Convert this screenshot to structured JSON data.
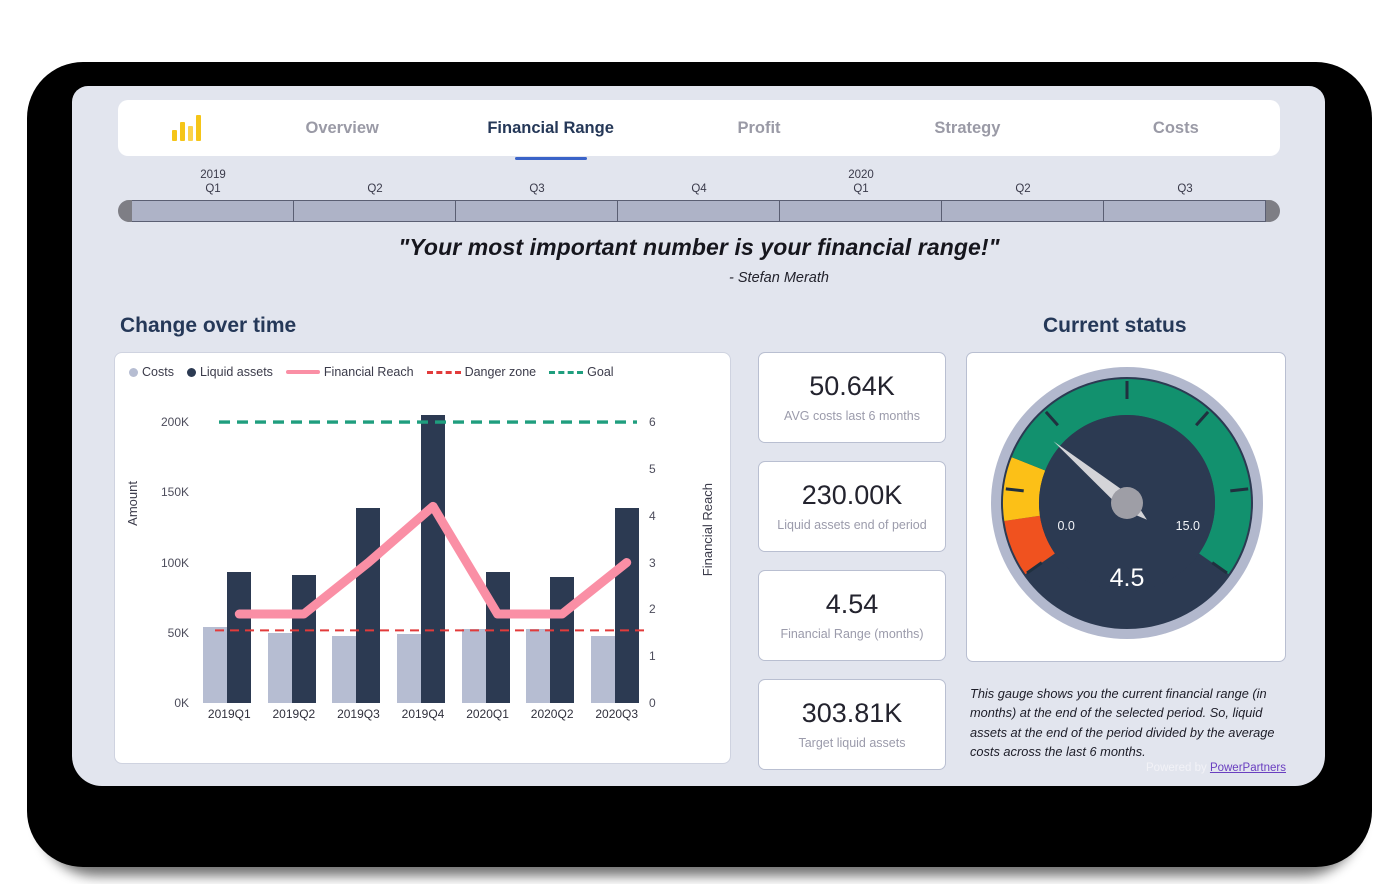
{
  "navbar": {
    "logo_icon": "bar-chart-icon",
    "items": [
      {
        "label": "Overview",
        "active": false
      },
      {
        "label": "Financial Range",
        "active": true
      },
      {
        "label": "Profit",
        "active": false
      },
      {
        "label": "Strategy",
        "active": false
      },
      {
        "label": "Costs",
        "active": false
      }
    ]
  },
  "slicer": {
    "ticks": [
      {
        "year": "2019",
        "quarter": "Q1"
      },
      {
        "year": "",
        "quarter": "Q2"
      },
      {
        "year": "",
        "quarter": "Q3"
      },
      {
        "year": "",
        "quarter": "Q4"
      },
      {
        "year": "2020",
        "quarter": "Q1"
      },
      {
        "year": "",
        "quarter": "Q2"
      },
      {
        "year": "",
        "quarter": "Q3"
      }
    ]
  },
  "quote": {
    "text": "\"Your most important number is your financial range!\"",
    "author": "- Stefan Merath"
  },
  "sections": {
    "left_title": "Change over time",
    "right_title": "Current status"
  },
  "kpis": [
    {
      "value": "50.64K",
      "label": "AVG costs last 6 months"
    },
    {
      "value": "230.00K",
      "label": "Liquid assets end of period"
    },
    {
      "value": "4.54",
      "label": "Financial Range (months)"
    },
    {
      "value": "303.81K",
      "label": "Target liquid assets"
    }
  ],
  "gauge": {
    "min_label": "0.0",
    "max_label": "15.0",
    "value_label": "4.5",
    "value": 4.5,
    "min": 0,
    "max": 15,
    "bands": [
      {
        "from": 0,
        "to": 1.6,
        "color": "#f0521f"
      },
      {
        "from": 1.6,
        "to": 3.4,
        "color": "#fcc017"
      },
      {
        "from": 3.4,
        "to": 15,
        "color": "#12916e"
      }
    ],
    "dial_face": "#2c3a52",
    "rim": "#b2b8cd",
    "needle": "#d4d4d8",
    "hub": "#9e9ea6",
    "note": "This gauge shows you the current financial range (in months) at the end of the selected period. So, liquid assets at the end of the period divided by the average costs across the last 6 months."
  },
  "footer": {
    "prefix": "Powered by ",
    "link": "PowerPartners"
  },
  "chart_data": {
    "type": "bar",
    "title": "Change over time",
    "xlabel": "",
    "ylabel": "Amount",
    "y2label": "Financial Reach",
    "categories": [
      "2019Q1",
      "2019Q2",
      "2019Q3",
      "2019Q4",
      "2020Q1",
      "2020Q2",
      "2020Q3"
    ],
    "ylim": [
      0,
      215000
    ],
    "yticks": [
      0,
      50000,
      100000,
      150000,
      200000
    ],
    "ytick_labels": [
      "0K",
      "50K",
      "100K",
      "150K",
      "200K"
    ],
    "y2lim": [
      0,
      6.45
    ],
    "y2ticks": [
      0,
      1,
      2,
      3,
      4,
      5,
      6
    ],
    "y2tick_labels": [
      "0",
      "1",
      "2",
      "3",
      "4",
      "5",
      "6"
    ],
    "grid": false,
    "legend_position": "top-left",
    "series": [
      {
        "name": "Costs",
        "type": "bar",
        "axis": "left",
        "color": "#b6bdd2",
        "values": [
          54000,
          50000,
          48000,
          49000,
          53000,
          53000,
          48000
        ]
      },
      {
        "name": "Liquid assets",
        "type": "bar",
        "axis": "left",
        "color": "#2c3a52",
        "values": [
          93000,
          91000,
          139000,
          205000,
          93000,
          90000,
          139000
        ]
      },
      {
        "name": "Financial Reach",
        "type": "line",
        "axis": "right",
        "color": "#fa8fa5",
        "values": [
          1.9,
          1.9,
          3.0,
          4.2,
          1.9,
          1.9,
          3.0
        ]
      },
      {
        "name": "Danger zone",
        "type": "hline",
        "axis": "right",
        "color": "#e23b3b",
        "style": "dashed",
        "value": 1.55
      },
      {
        "name": "Goal",
        "type": "hline",
        "axis": "right",
        "color": "#1f9e7e",
        "style": "dashed",
        "value": 6.0
      }
    ]
  }
}
